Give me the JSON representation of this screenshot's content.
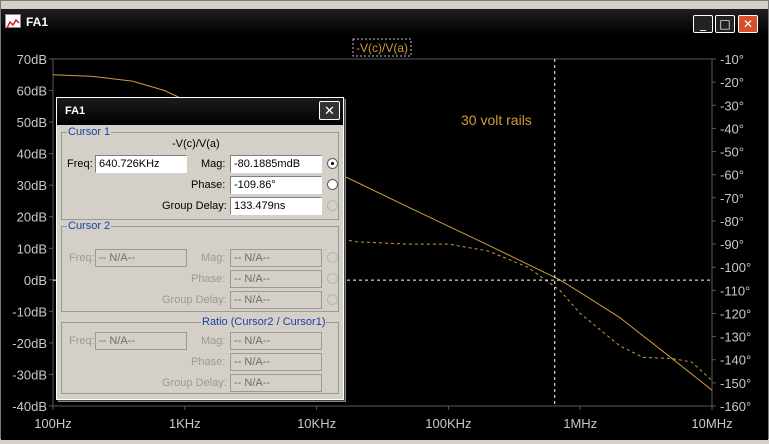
{
  "window": {
    "title": "FA1",
    "minimize_glyph": "_",
    "maximize_glyph": "□",
    "close_glyph": "✕"
  },
  "plot": {
    "trace_label": "-V(c)/V(a)",
    "annotation": "30 volt rails",
    "colors": {
      "background": "#000000",
      "trace": "#d09a3c",
      "grid": "#5a5a5a",
      "text": "#c8c8c8",
      "cursor": "#ffffff"
    }
  },
  "chart_data": {
    "type": "line",
    "title": "",
    "xlabel": "",
    "ylabel": "",
    "xscale": "log",
    "xlim": [
      100,
      10000000
    ],
    "ylim": [
      -40,
      70
    ],
    "y2lim": [
      -160,
      -10
    ],
    "x_ticks": [
      "100Hz",
      "1KHz",
      "10KHz",
      "100KHz",
      "1MHz",
      "10MHz"
    ],
    "y_ticks": [
      "70dB",
      "60dB",
      "50dB",
      "40dB",
      "30dB",
      "20dB",
      "10dB",
      "0dB",
      "-10dB",
      "-20dB",
      "-30dB",
      "-40dB"
    ],
    "y2_ticks": [
      "-10°",
      "-20°",
      "-30°",
      "-40°",
      "-50°",
      "-60°",
      "-70°",
      "-80°",
      "-90°",
      "-100°",
      "-110°",
      "-120°",
      "-130°",
      "-140°",
      "-150°",
      "-160°"
    ],
    "series": [
      {
        "name": "-V(c)/V(a)",
        "axis": "left",
        "style": "solid",
        "x": [
          100,
          200,
          400,
          700,
          1000,
          2000,
          5000,
          10000,
          20000,
          50000,
          100000,
          200000,
          500000,
          700000,
          1000000,
          2000000,
          5000000,
          10000000
        ],
        "y": [
          65,
          64.5,
          63,
          60,
          57,
          51,
          43,
          37,
          31,
          23,
          17,
          11,
          3,
          0,
          -4,
          -12,
          -25,
          -35
        ]
      },
      {
        "name": "phase",
        "axis": "right",
        "style": "dashed",
        "x": [
          1000,
          2000,
          5000,
          10000,
          20000,
          50000,
          100000,
          200000,
          400000,
          700000,
          1000000,
          2000000,
          3000000,
          5000000,
          7000000,
          10000000
        ],
        "y": [
          -33,
          -55,
          -78,
          -86,
          -89,
          -90,
          -90,
          -93,
          -100,
          -110,
          -120,
          -134,
          -139,
          -139.5,
          -141,
          -149
        ]
      }
    ],
    "cursor": {
      "x": 640726,
      "y": -0.08
    },
    "grid": false,
    "legend": "top-center"
  },
  "cursor_dialog": {
    "title": "FA1",
    "close_glyph": "✕",
    "cursor1": {
      "group_label": "Cursor 1",
      "trace": "-V(c)/V(a)",
      "freq_label": "Freq:",
      "freq": "640.726KHz",
      "mag_label": "Mag:",
      "mag": "-80.1885mdB",
      "phase_label": "Phase:",
      "phase": "-109.86°",
      "group_delay_label": "Group Delay:",
      "group_delay": "133.479ns"
    },
    "cursor2": {
      "group_label": "Cursor 2",
      "freq_label": "Freq:",
      "freq": "-- N/A--",
      "mag_label": "Mag:",
      "mag": "-- N/A--",
      "phase_label": "Phase:",
      "phase": "-- N/A--",
      "group_delay_label": "Group Delay:",
      "group_delay": "-- N/A--"
    },
    "ratio": {
      "group_label": "Ratio (Cursor2 / Cursor1)",
      "freq_label": "Freq:",
      "freq": "-- N/A--",
      "mag_label": "Mag:",
      "mag": "-- N/A--",
      "phase_label": "Phase:",
      "phase": "-- N/A--",
      "group_delay_label": "Group Delay:",
      "group_delay": "-- N/A--"
    }
  }
}
